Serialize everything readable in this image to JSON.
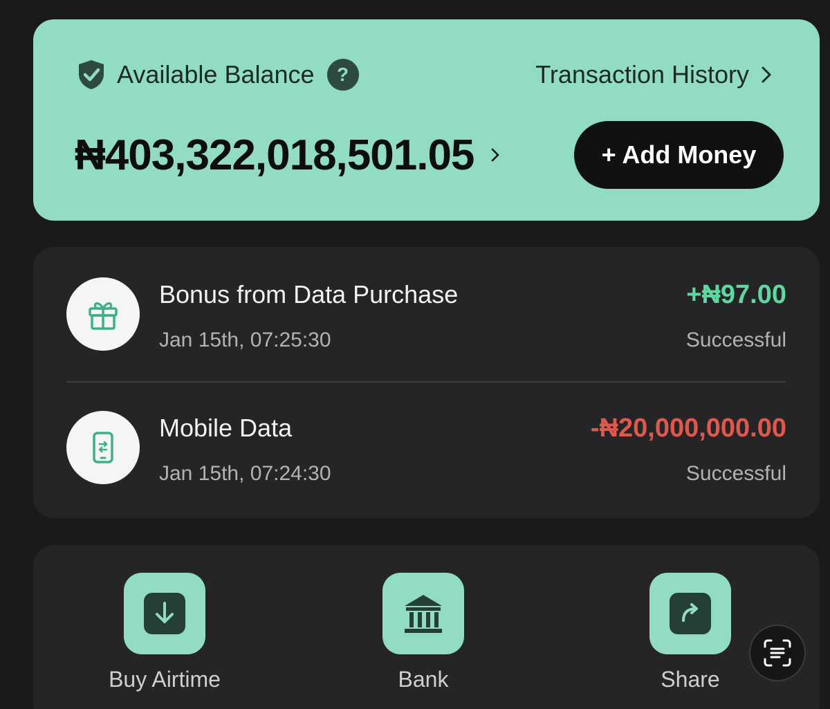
{
  "balance": {
    "label": "Available Balance",
    "help_glyph": "?",
    "history_label": "Transaction History",
    "amount": "₦403,322,018,501.05",
    "add_money_label": "+ Add Money"
  },
  "transactions": [
    {
      "icon": "gift-icon",
      "title": "Bonus from Data Purchase",
      "date": "Jan 15th, 07:25:30",
      "amount": "+₦97.00",
      "status": "Successful"
    },
    {
      "icon": "mobile-data-icon",
      "title": "Mobile Data",
      "date": "Jan 15th, 07:24:30",
      "amount": "-₦20,000,000.00",
      "status": "Successful"
    }
  ],
  "actions": [
    {
      "icon": "download-icon",
      "label": "Buy Airtime"
    },
    {
      "icon": "bank-icon",
      "label": "Bank"
    },
    {
      "icon": "share-icon",
      "label": "Share"
    }
  ],
  "fab": {
    "icon": "scan-text-icon"
  },
  "colors": {
    "accent": "#92dcc3",
    "background": "#1a1a1c",
    "card": "#252527",
    "positive": "#5ed89e",
    "negative": "#e2574c"
  }
}
